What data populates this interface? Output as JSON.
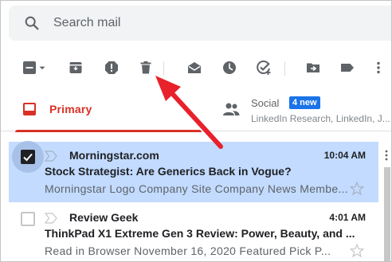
{
  "search": {
    "placeholder": "Search mail"
  },
  "toolbar": {
    "icons": [
      "select-checkbox-icon",
      "dropdown-caret-icon",
      "archive-icon",
      "report-spam-icon",
      "delete-trash-icon",
      "mark-read-icon",
      "snooze-clock-icon",
      "add-task-icon",
      "move-to-icon",
      "label-icon"
    ]
  },
  "tabs": {
    "primary": {
      "label": "Primary"
    },
    "social": {
      "label": "Social",
      "badge": "4 new",
      "subtitle": "LinkedIn Research, LinkedIn, J..."
    }
  },
  "emails": [
    {
      "sender": "Morningstar.com",
      "time": "10:04 AM",
      "subject": "Stock Strategist: Are Generics Back in Vogue?",
      "snippet": "Morningstar Logo Company Site Company News Membe...",
      "selected": true
    },
    {
      "sender": "Review Geek",
      "time": "4:01 AM",
      "subject": "ThinkPad X1 Extreme Gen 3 Review: Power, Beauty, and ...",
      "snippet": "Read in Browser November 16, 2020 Featured Pick P...",
      "selected": false
    }
  ],
  "colors": {
    "accent_red": "#d93025",
    "badge_blue": "#1a73e8",
    "selected_row": "#c2dbff",
    "annotation": "#e8212b"
  }
}
